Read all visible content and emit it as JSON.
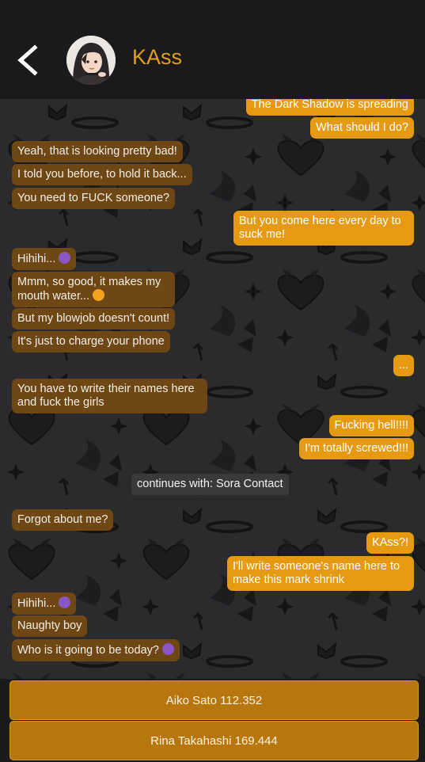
{
  "header": {
    "title": "KAss",
    "back_icon": "chevron-left-icon",
    "avatar_icon": "avatar"
  },
  "colors": {
    "accent": "#e3a11b",
    "incoming": "#6e4714",
    "outgoing": "#e59a12",
    "choice": "#b8760e"
  },
  "messages": [
    {
      "side": "out",
      "text": "The Dark Shadow is spreading"
    },
    {
      "side": "out",
      "text": "What should I do?"
    },
    {
      "side": "in",
      "text": "Yeah, that is looking pretty bad!"
    },
    {
      "side": "in",
      "text": "I told you before, to hold it back..."
    },
    {
      "side": "in",
      "text": "You need to FUCK someone?"
    },
    {
      "side": "out",
      "text": "But you come here every day to",
      "text2": "suck me!"
    },
    {
      "side": "in",
      "text": "Hihihi...",
      "emoji": "smiling-devil-icon"
    },
    {
      "side": "in",
      "text": "Mmm, so good, it makes my",
      "text2": "mouth water...",
      "emoji": "yum-face-icon"
    },
    {
      "side": "in",
      "text": "But my blowjob doesn't count!"
    },
    {
      "side": "in",
      "text": "It's just to charge your phone"
    },
    {
      "side": "out",
      "text": "..."
    },
    {
      "side": "in",
      "text": "You have to write their names here",
      "text2": "and fuck the girls"
    },
    {
      "side": "out",
      "text": "Fucking hell!!!!"
    },
    {
      "side": "out",
      "text": "I'm totally screwed!!!"
    },
    {
      "side": "system",
      "text": "continues with: Sora Contact"
    },
    {
      "side": "in",
      "text": "Forgot about me?"
    },
    {
      "side": "out",
      "text": "KAss?!"
    },
    {
      "side": "out",
      "text": "I'll write someone's name here to",
      "text2": "make this mark shrink"
    },
    {
      "side": "in",
      "text": "Hihihi...",
      "emoji": "smiling-devil-icon"
    },
    {
      "side": "in",
      "text": "Naughty boy"
    },
    {
      "side": "in",
      "text": "Who is it going to be today?",
      "emoji": "smiling-devil-icon"
    }
  ],
  "choices": [
    {
      "label": "Aiko Sato 112.352"
    },
    {
      "label": "Rina Takahashi 169.444"
    }
  ]
}
